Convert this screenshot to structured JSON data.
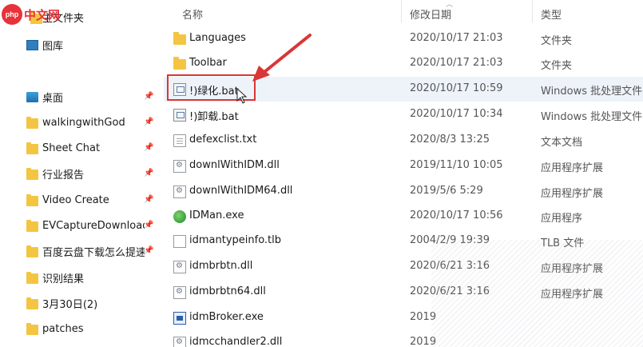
{
  "watermark": {
    "logo_text": "php",
    "text": "中文网"
  },
  "sidebar": {
    "items": [
      {
        "label": "主文件夹",
        "icon": "home-folder-icon",
        "pinned": false
      },
      {
        "label": "图库",
        "icon": "gallery-icon",
        "pinned": false
      },
      {
        "label": "桌面",
        "icon": "desktop-icon",
        "pinned": true
      },
      {
        "label": "walkingwithGod",
        "icon": "folder-icon",
        "pinned": true
      },
      {
        "label": "Sheet Chat",
        "icon": "folder-icon",
        "pinned": true
      },
      {
        "label": "行业报告",
        "icon": "folder-icon",
        "pinned": true
      },
      {
        "label": "Video Create",
        "icon": "folder-icon",
        "pinned": true
      },
      {
        "label": "EVCaptureDownload",
        "icon": "folder-icon",
        "pinned": true
      },
      {
        "label": "百度云盘下载怎么提速?",
        "icon": "folder-icon",
        "pinned": true
      },
      {
        "label": "识别结果",
        "icon": "folder-icon",
        "pinned": false
      },
      {
        "label": "3月30日(2)",
        "icon": "folder-icon",
        "pinned": false
      },
      {
        "label": "patches",
        "icon": "folder-icon",
        "pinned": false
      }
    ]
  },
  "columns": {
    "name": "名称",
    "date": "修改日期",
    "type": "类型"
  },
  "files": [
    {
      "name": "Languages",
      "date": "2020/10/17 21:03",
      "type": "文件夹",
      "icon": "folder"
    },
    {
      "name": "Toolbar",
      "date": "2020/10/17 21:03",
      "type": "文件夹",
      "icon": "folder"
    },
    {
      "name": "!)绿化.bat",
      "date": "2020/10/17 10:59",
      "type": "Windows 批处理文件",
      "icon": "bat"
    },
    {
      "name": "!)卸载.bat",
      "date": "2020/10/17 10:34",
      "type": "Windows 批处理文件",
      "icon": "bat"
    },
    {
      "name": "defexclist.txt",
      "date": "2020/8/3 13:25",
      "type": "文本文档",
      "icon": "txt"
    },
    {
      "name": "downlWithIDM.dll",
      "date": "2019/11/10 10:05",
      "type": "应用程序扩展",
      "icon": "dll"
    },
    {
      "name": "downlWithIDM64.dll",
      "date": "2019/5/6 5:29",
      "type": "应用程序扩展",
      "icon": "dll"
    },
    {
      "name": "IDMan.exe",
      "date": "2020/10/17 10:56",
      "type": "应用程序",
      "icon": "exe"
    },
    {
      "name": "idmantypeinfo.tlb",
      "date": "2004/2/9 19:39",
      "type": "TLB 文件",
      "icon": "blank"
    },
    {
      "name": "idmbrbtn.dll",
      "date": "2020/6/21 3:16",
      "type": "应用程序扩展",
      "icon": "dll"
    },
    {
      "name": "idmbrbtn64.dll",
      "date": "2020/6/21 3:16",
      "type": "应用程序扩展",
      "icon": "dll"
    },
    {
      "name": "idmBroker.exe",
      "date": "2019",
      "type": "",
      "icon": "app"
    },
    {
      "name": "idmcchandler2.dll",
      "date": "2019",
      "type": "",
      "icon": "dll"
    }
  ]
}
